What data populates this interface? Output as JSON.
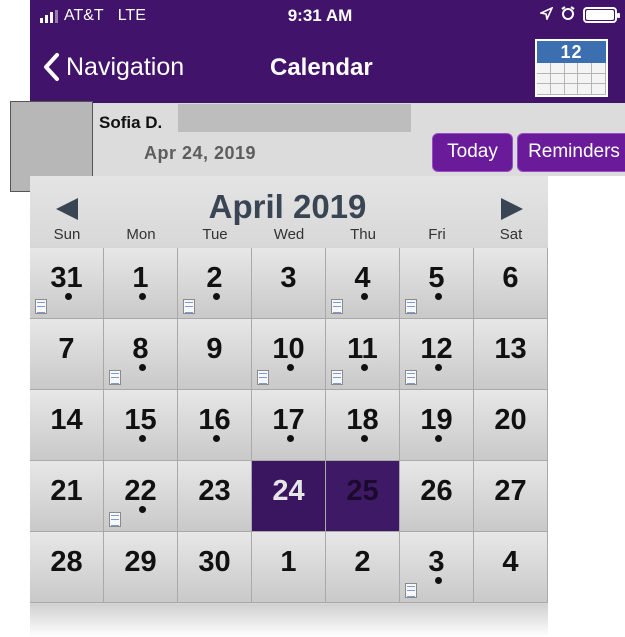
{
  "status": {
    "carrier": "AT&T",
    "network": "LTE",
    "time": "9:31 AM"
  },
  "nav": {
    "back_label": "Navigation",
    "title": "Calendar",
    "calendar_icon_number": "12"
  },
  "header": {
    "user_name": "Sofia D.",
    "selected_date": "Apr 24, 2019",
    "today_label": "Today",
    "reminders_label": "Reminders"
  },
  "calendar": {
    "month_title": "April 2019",
    "weekdays": [
      "Sun",
      "Mon",
      "Tue",
      "Wed",
      "Thu",
      "Fri",
      "Sat"
    ],
    "days": [
      {
        "label": "31",
        "dot": true,
        "note": true
      },
      {
        "label": "1",
        "dot": true,
        "note": false
      },
      {
        "label": "2",
        "dot": true,
        "note": true
      },
      {
        "label": "3",
        "dot": false,
        "note": false
      },
      {
        "label": "4",
        "dot": true,
        "note": true
      },
      {
        "label": "5",
        "dot": true,
        "note": true
      },
      {
        "label": "6",
        "dot": false,
        "note": false
      },
      {
        "label": "7",
        "dot": false,
        "note": false
      },
      {
        "label": "8",
        "dot": true,
        "note": true
      },
      {
        "label": "9",
        "dot": false,
        "note": false
      },
      {
        "label": "10",
        "dot": true,
        "note": true
      },
      {
        "label": "11",
        "dot": true,
        "note": true
      },
      {
        "label": "12",
        "dot": true,
        "note": true
      },
      {
        "label": "13",
        "dot": false,
        "note": false
      },
      {
        "label": "14",
        "dot": false,
        "note": false
      },
      {
        "label": "15",
        "dot": true,
        "note": false
      },
      {
        "label": "16",
        "dot": true,
        "note": false
      },
      {
        "label": "17",
        "dot": true,
        "note": false
      },
      {
        "label": "18",
        "dot": true,
        "note": false
      },
      {
        "label": "19",
        "dot": true,
        "note": false
      },
      {
        "label": "20",
        "dot": false,
        "note": false
      },
      {
        "label": "21",
        "dot": false,
        "note": false
      },
      {
        "label": "22",
        "dot": true,
        "note": true
      },
      {
        "label": "23",
        "dot": false,
        "note": false
      },
      {
        "label": "24",
        "dot": false,
        "note": false,
        "state": "selected"
      },
      {
        "label": "25",
        "dot": false,
        "note": false,
        "state": "highlighted"
      },
      {
        "label": "26",
        "dot": false,
        "note": false
      },
      {
        "label": "27",
        "dot": false,
        "note": false
      },
      {
        "label": "28",
        "dot": false,
        "note": false
      },
      {
        "label": "29",
        "dot": false,
        "note": false
      },
      {
        "label": "30",
        "dot": false,
        "note": false
      },
      {
        "label": "1",
        "dot": false,
        "note": false
      },
      {
        "label": "2",
        "dot": false,
        "note": false
      },
      {
        "label": "3",
        "dot": true,
        "note": true
      },
      {
        "label": "4",
        "dot": false,
        "note": false
      }
    ]
  },
  "colors": {
    "nav_bar": "#41136a",
    "button": "#6a1b9a",
    "selected_day": "#3a1560"
  }
}
